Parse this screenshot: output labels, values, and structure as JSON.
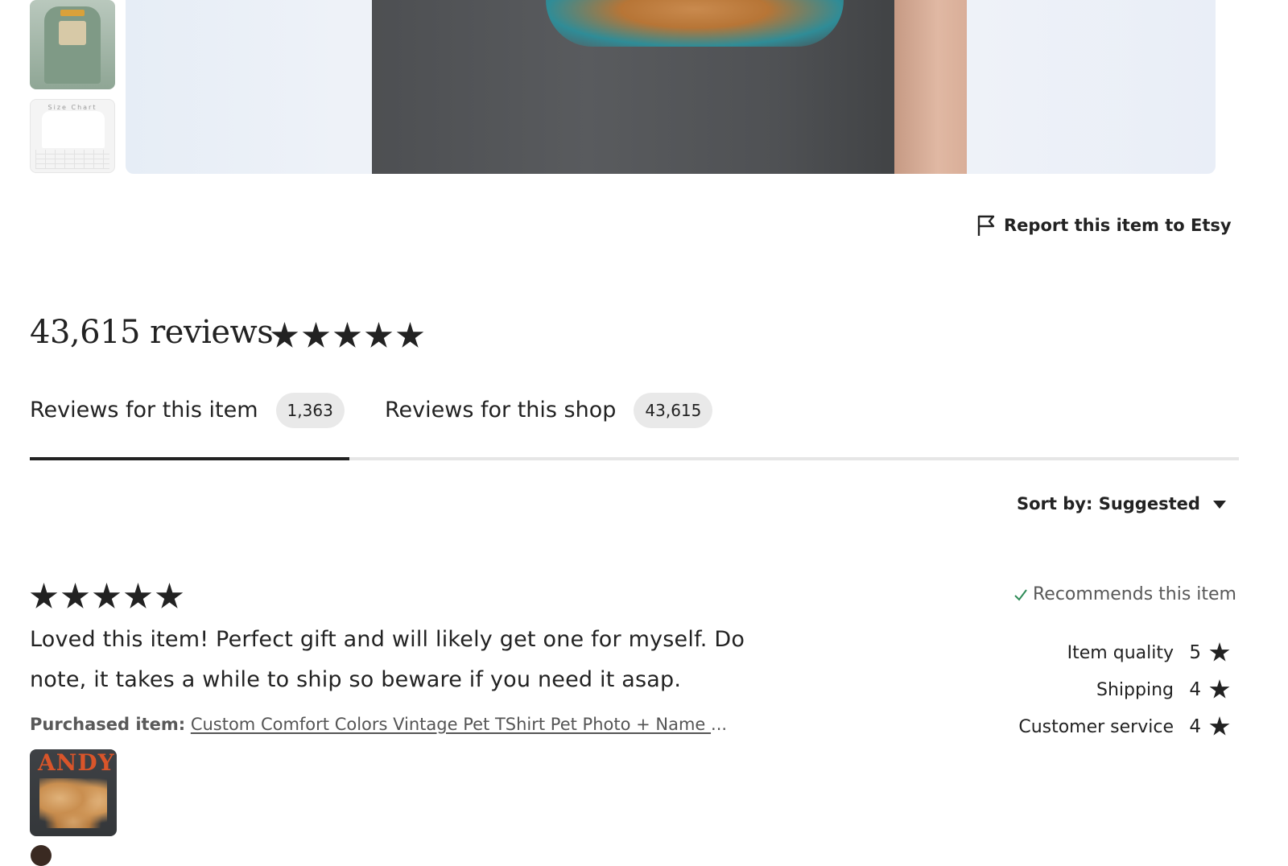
{
  "gallery": {
    "thumbnails": [
      {
        "alt": "T-shirt photo thumbnail"
      },
      {
        "caption": "Size Chart"
      }
    ]
  },
  "report": {
    "label": "Report this item to Etsy"
  },
  "reviews": {
    "total_label": "43,615 reviews",
    "rating_stars": 5
  },
  "tabs": [
    {
      "label": "Reviews for this item",
      "count": "1,363",
      "active": true
    },
    {
      "label": "Reviews for this shop",
      "count": "43,615",
      "active": false
    }
  ],
  "sort": {
    "label": "Sort by: Suggested"
  },
  "review": {
    "stars": 5,
    "text": "Loved this item! Perfect gift and will likely get one for myself. Do note, it takes a while to ship so beware if you need it asap.",
    "purchased_label": "Purchased item:",
    "purchased_link": "Custom Comfort Colors Vintage Pet TShirt Pet Photo + Name ",
    "purchased_ellipsis": "...",
    "photo_text": "ANDY",
    "recommends": "Recommends this item",
    "ratings": [
      {
        "label": "Item quality",
        "value": "5"
      },
      {
        "label": "Shipping",
        "value": "4"
      },
      {
        "label": "Customer service",
        "value": "4"
      }
    ]
  },
  "colors": {
    "text": "#222222",
    "muted": "#595959",
    "check": "#2e8b57"
  }
}
